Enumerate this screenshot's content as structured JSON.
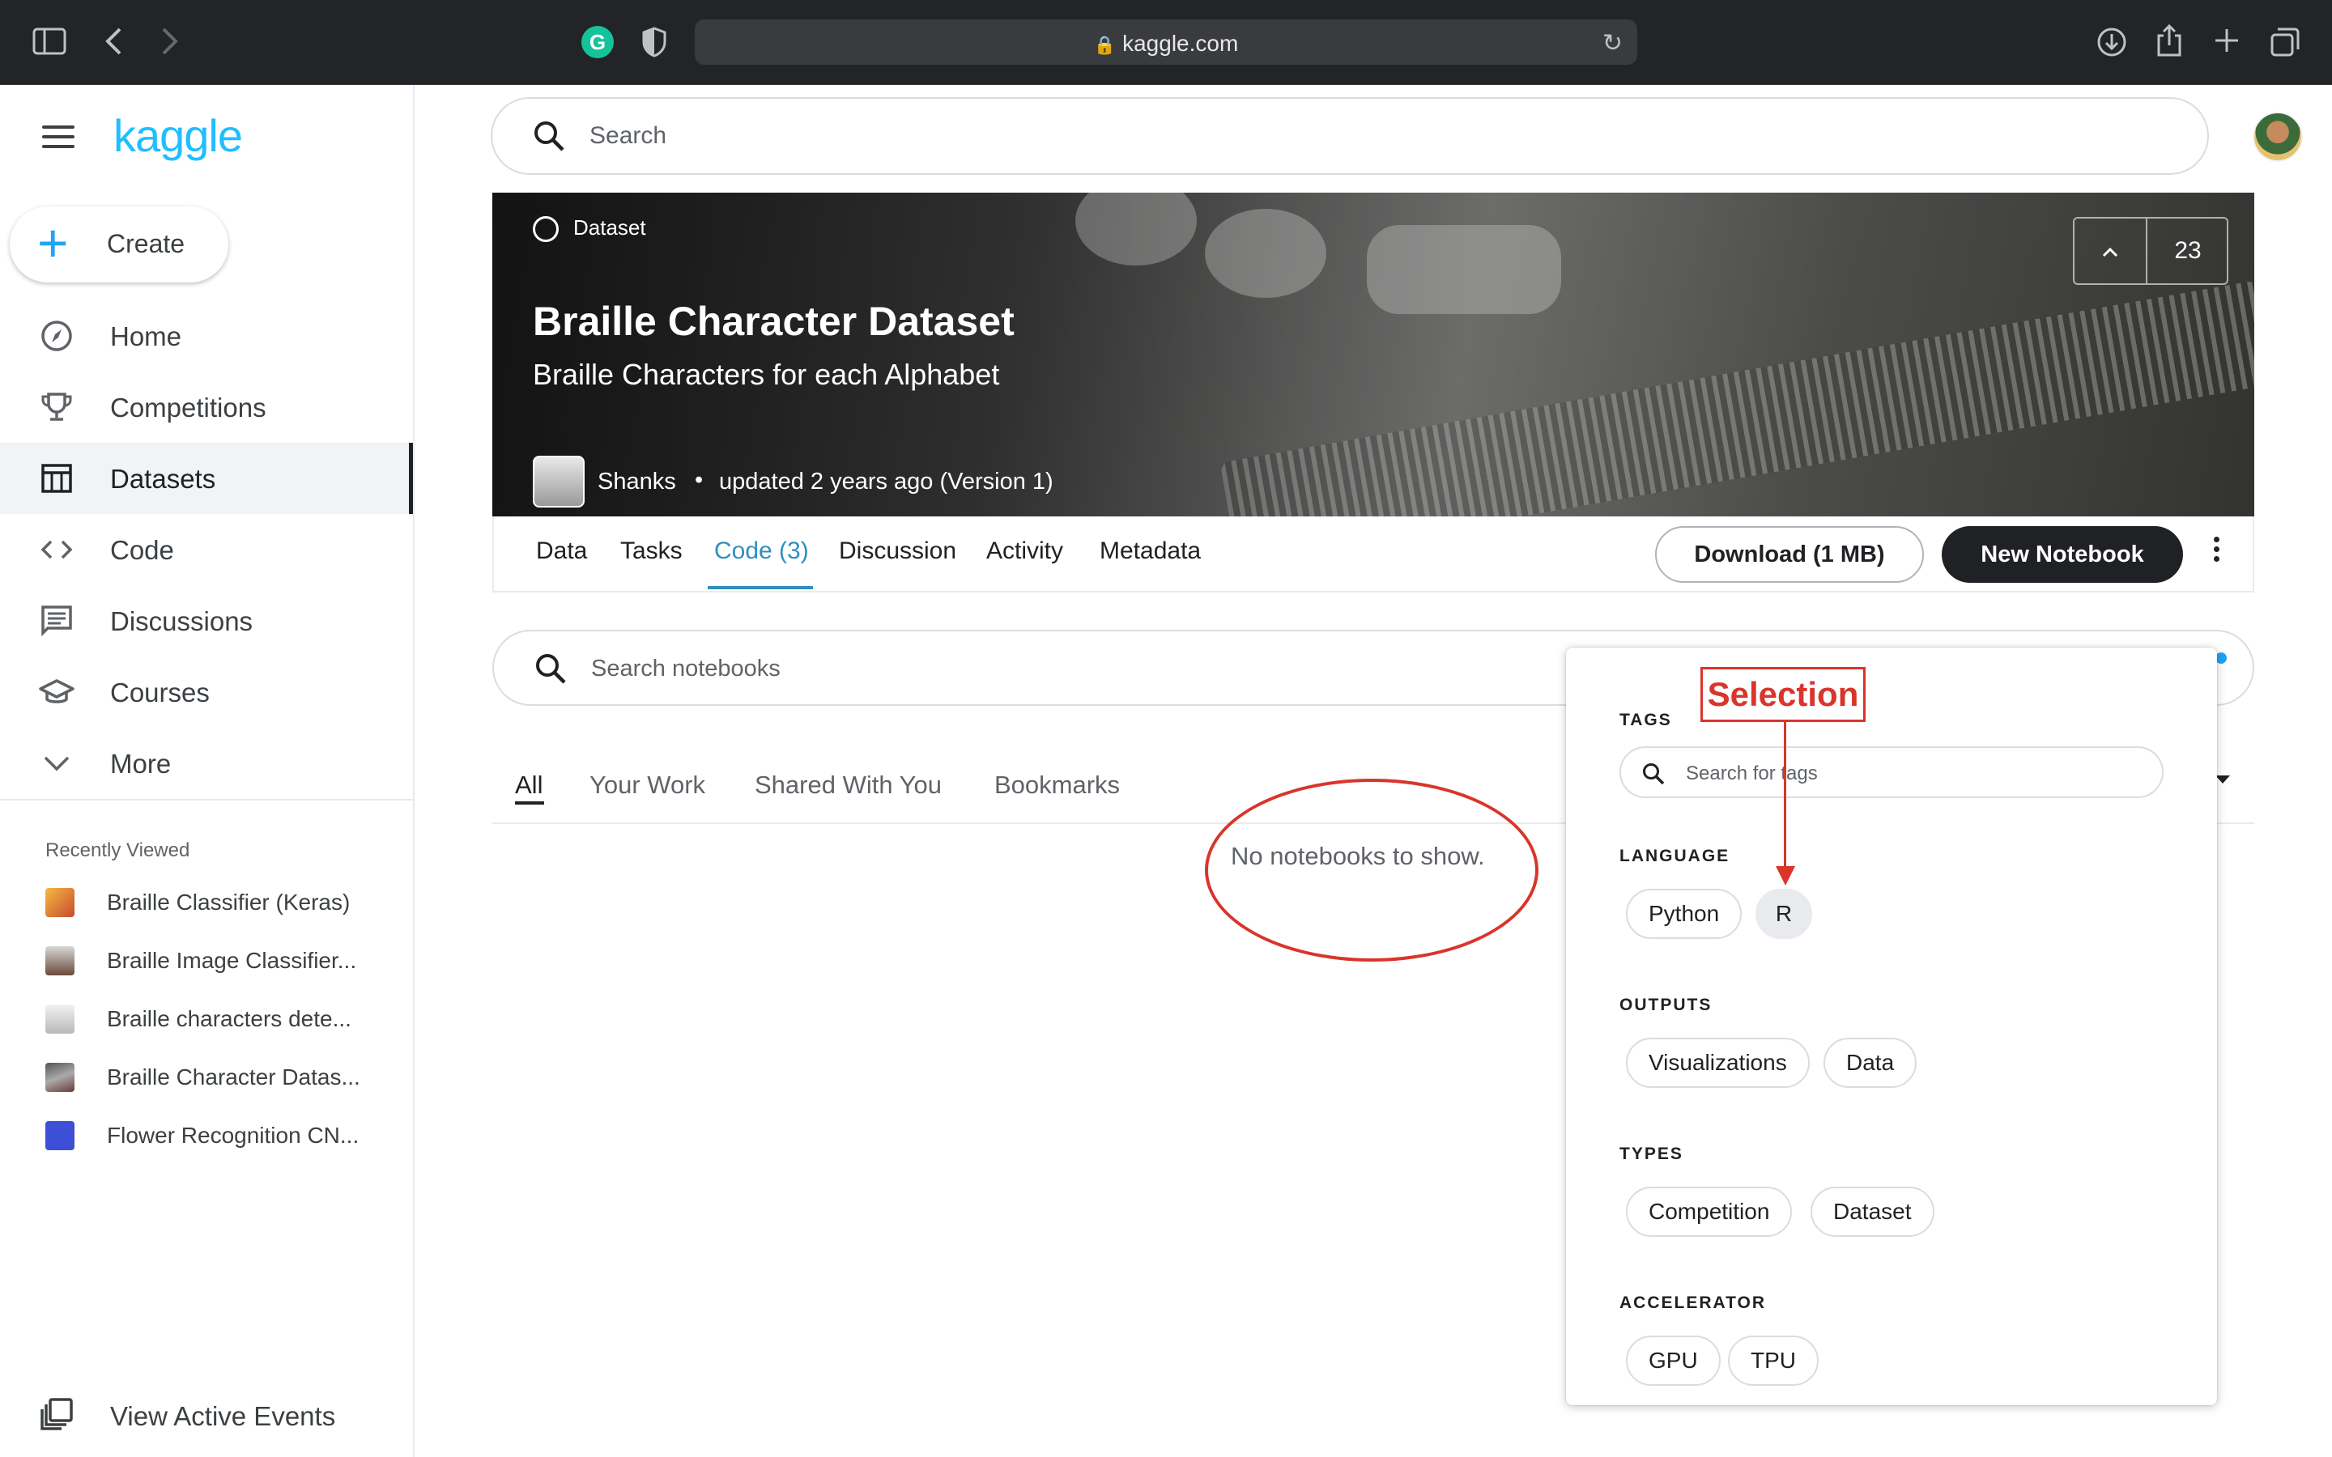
{
  "browser": {
    "host": "kaggle.com",
    "icons": [
      "sidebar-toggle-icon",
      "back-icon",
      "forward-icon",
      "grammarly-icon",
      "shield-icon",
      "lock-icon",
      "reload-icon",
      "download-icon",
      "share-icon",
      "new-tab-icon",
      "tab-overview-icon"
    ],
    "grammarly_letter": "G"
  },
  "sidebar": {
    "logo": "kaggle",
    "create_label": "Create",
    "items": [
      {
        "label": "Home",
        "icon": "compass-icon"
      },
      {
        "label": "Competitions",
        "icon": "trophy-icon"
      },
      {
        "label": "Datasets",
        "icon": "table-icon",
        "active": true
      },
      {
        "label": "Code",
        "icon": "code-icon"
      },
      {
        "label": "Discussions",
        "icon": "comments-icon"
      },
      {
        "label": "Courses",
        "icon": "graduation-cap-icon"
      },
      {
        "label": "More",
        "icon": "chevron-down-icon"
      }
    ],
    "recent_title": "Recently Viewed",
    "recent": [
      {
        "label": "Braille Classifier (Keras)"
      },
      {
        "label": "Braille Image Classifier..."
      },
      {
        "label": "Braille characters dete..."
      },
      {
        "label": "Braille Character Datas..."
      },
      {
        "label": "Flower Recognition CN..."
      }
    ],
    "events_label": "View Active Events"
  },
  "search": {
    "placeholder": "Search"
  },
  "hero": {
    "kind": "Dataset",
    "title": "Braille Character Dataset",
    "subtitle": "Braille Characters for each Alphabet",
    "owner": "Shanks",
    "separator": "•",
    "updated": "updated 2 years ago (Version 1)",
    "vote_up": "^",
    "vote_count": "23"
  },
  "tabs": {
    "items": [
      "Data",
      "Tasks",
      "Code (3)",
      "Discussion",
      "Activity",
      "Metadata"
    ],
    "active": "Code (3)",
    "download_label": "Download (1 MB)",
    "new_notebook_label": "New Notebook"
  },
  "notebooks": {
    "search_placeholder": "Search notebooks",
    "subtabs": [
      "All",
      "Your Work",
      "Shared With You",
      "Bookmarks"
    ],
    "empty_text": "No notebooks to show."
  },
  "filters": {
    "tags_label": "TAGS",
    "tags_placeholder": "Search for tags",
    "language_label": "LANGUAGE",
    "language": [
      "Python",
      "R"
    ],
    "language_selected": "R",
    "outputs_label": "OUTPUTS",
    "outputs": [
      "Visualizations",
      "Data"
    ],
    "types_label": "TYPES",
    "types": [
      "Competition",
      "Dataset"
    ],
    "accelerator_label": "ACCELERATOR",
    "accelerator": [
      "GPU",
      "TPU"
    ]
  },
  "annotation": {
    "label": "Selection",
    "color": "#d9352b"
  },
  "colors": {
    "brand": "#20beff",
    "accent": "#2f8fbf",
    "dark_button": "#202124"
  }
}
